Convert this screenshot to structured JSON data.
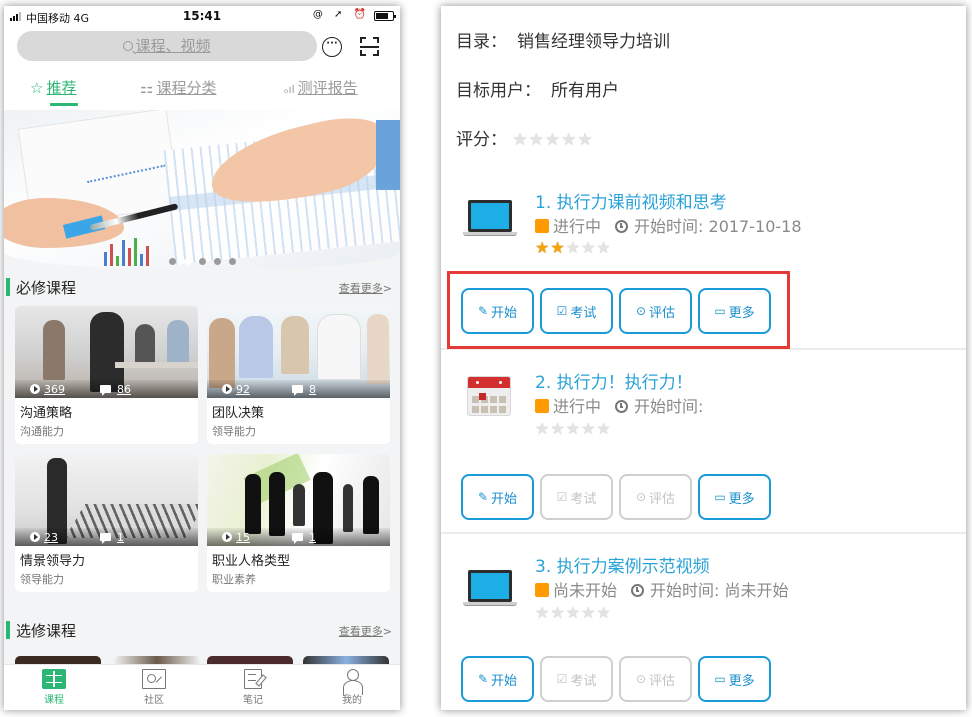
{
  "phone": {
    "statusbar": {
      "carrier": "中国移动  4G",
      "time": "15:41",
      "sys_icons": "@ ➚ ⏰"
    },
    "search": {
      "placeholder": "课程、视频",
      "icons": [
        "search-icon",
        "chat-bubble-icon",
        "scan-icon"
      ]
    },
    "tabs": [
      {
        "label": "推荐",
        "icon": "star-icon",
        "active": true
      },
      {
        "label": "课程分类",
        "icon": "grid-icon",
        "active": false
      },
      {
        "label": "测评报告",
        "icon": "bar-chart-icon",
        "active": false
      }
    ],
    "banner": {
      "slide_count": 5,
      "active_slide": 2
    },
    "required_section": {
      "title": "必修课程",
      "more": "查看更多",
      "more_arrow": ">"
    },
    "courses": [
      {
        "title": "沟通策略",
        "category": "沟通能力",
        "plays": "369",
        "comments": "86"
      },
      {
        "title": "团队决策",
        "category": "领导能力",
        "plays": "92",
        "comments": "8"
      },
      {
        "title": "情景领导力",
        "category": "领导能力",
        "plays": "23",
        "comments": "1"
      },
      {
        "title": "职业人格类型",
        "category": "职业素养",
        "plays": "15",
        "comments": "1"
      }
    ],
    "elective_section": {
      "title": "选修课程",
      "more": "查看更多",
      "more_arrow": ">"
    },
    "tabbar": [
      {
        "label": "课程",
        "icon": "book-icon",
        "active": true
      },
      {
        "label": "社区",
        "icon": "community-icon",
        "active": false
      },
      {
        "label": "笔记",
        "icon": "note-icon",
        "active": false
      },
      {
        "label": "我的",
        "icon": "person-icon",
        "active": false
      }
    ],
    "accent_color": "#2bb673"
  },
  "panel": {
    "catalog_label": "目录：",
    "catalog_value": "销售经理领导力培训",
    "target_label": "目标用户：",
    "target_value": "所有用户",
    "rating_label": "评分：",
    "rating": 0,
    "rating_max": 5,
    "start_time_label": "开始时间:",
    "items": [
      {
        "title": "1. 执行力课前视频和思考",
        "thumb": "laptop-icon",
        "status": "进行中",
        "start_time": "2017-10-18",
        "rating": 2,
        "buttons": [
          {
            "label": "开始",
            "icon": "✎",
            "enabled": true
          },
          {
            "label": "考试",
            "icon": "☑",
            "enabled": true
          },
          {
            "label": "评估",
            "icon": "⊙",
            "enabled": true
          },
          {
            "label": "更多",
            "icon": "▭",
            "enabled": true
          }
        ],
        "highlighted": true
      },
      {
        "title": "2. 执行力！执行力！",
        "thumb": "calendar-icon",
        "status": "进行中",
        "start_time": "",
        "rating": 0,
        "buttons": [
          {
            "label": "开始",
            "icon": "✎",
            "enabled": true
          },
          {
            "label": "考试",
            "icon": "☑",
            "enabled": false
          },
          {
            "label": "评估",
            "icon": "⊙",
            "enabled": false
          },
          {
            "label": "更多",
            "icon": "▭",
            "enabled": true
          }
        ],
        "highlighted": false
      },
      {
        "title": "3. 执行力案例示范视频",
        "thumb": "laptop-icon",
        "status": "尚未开始",
        "start_time": "尚未开始",
        "rating": 0,
        "buttons": [
          {
            "label": "开始",
            "icon": "✎",
            "enabled": true
          },
          {
            "label": "考试",
            "icon": "☑",
            "enabled": false
          },
          {
            "label": "评估",
            "icon": "⊙",
            "enabled": false
          },
          {
            "label": "更多",
            "icon": "▭",
            "enabled": true
          }
        ],
        "highlighted": false
      }
    ],
    "colors": {
      "title_blue": "#29a2d8",
      "button_border": "#1a9ad6",
      "status_orange": "#ff9a00",
      "star_on": "#f5a30a",
      "highlight_red": "#e53935"
    }
  }
}
